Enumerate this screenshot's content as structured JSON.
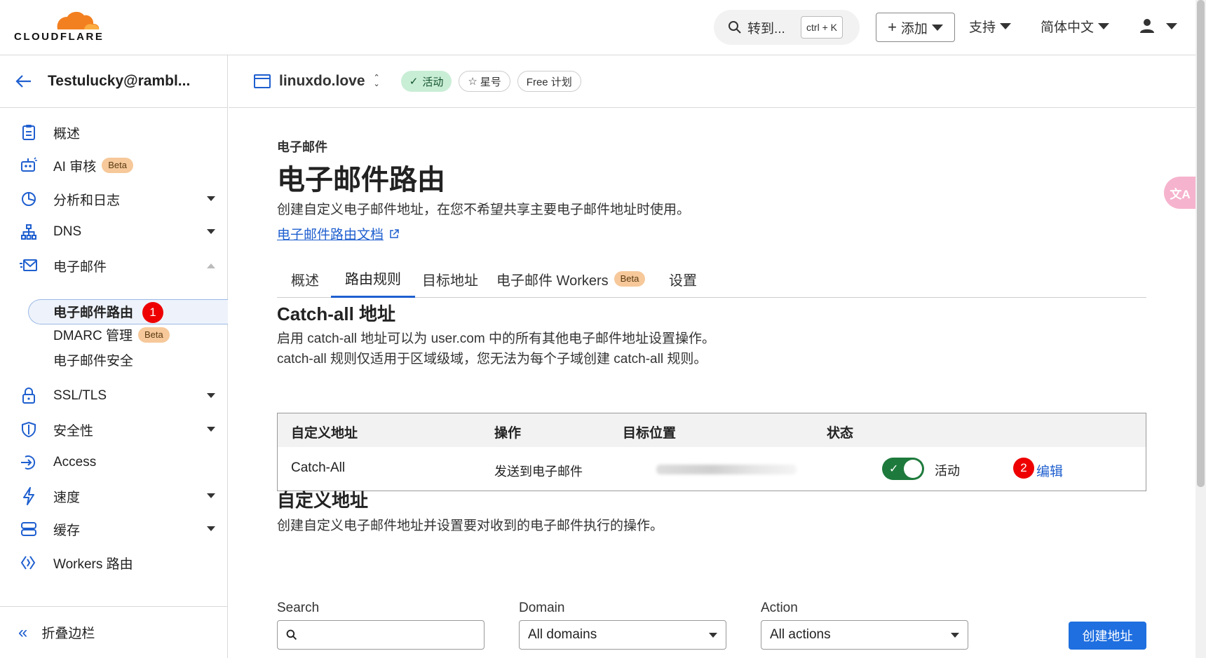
{
  "topbar": {
    "logo_text": "CLOUDFLARE",
    "search_label": "转到...",
    "search_shortcut": "ctrl + K",
    "add_label": "添加",
    "support_label": "支持",
    "language_label": "简体中文"
  },
  "sidebar": {
    "account_name": "Testulucky@rambl...",
    "items": [
      {
        "label": "概述",
        "icon": "document-icon"
      },
      {
        "label": "AI 审核",
        "icon": "robot-icon",
        "badge": "Beta"
      },
      {
        "label": "分析和日志",
        "icon": "chart-pie-icon"
      },
      {
        "label": "DNS",
        "icon": "sitemap-icon"
      },
      {
        "label": "电子邮件",
        "icon": "email-icon"
      },
      {
        "label": "SSL/TLS",
        "icon": "lock-icon"
      },
      {
        "label": "安全性",
        "icon": "shield-icon"
      },
      {
        "label": "Access",
        "icon": "access-icon"
      },
      {
        "label": "速度",
        "icon": "lightning-icon"
      },
      {
        "label": "缓存",
        "icon": "storage-icon"
      },
      {
        "label": "Workers 路由",
        "icon": "workers-icon"
      }
    ],
    "email_subitems": [
      {
        "label": "电子邮件路由",
        "step": "1"
      },
      {
        "label": "DMARC 管理",
        "badge": "Beta"
      },
      {
        "label": "电子邮件安全"
      }
    ],
    "collapse_label": "折叠边栏"
  },
  "zone": {
    "name": "linuxdo.love",
    "status": "活动",
    "star_label": "星号",
    "plan": "Free 计划"
  },
  "main": {
    "eyebrow": "电子邮件",
    "title": "电子邮件路由",
    "description": "创建自定义电子邮件地址，在您不希望共享主要电子邮件地址时使用。",
    "doc_link": "电子邮件路由文档",
    "tabs": [
      {
        "label": "概述"
      },
      {
        "label": "路由规则",
        "active": true
      },
      {
        "label": "目标地址"
      },
      {
        "label": "电子邮件 Workers",
        "badge": "Beta"
      },
      {
        "label": "设置"
      }
    ]
  },
  "catch_all": {
    "heading": "Catch-all 地址",
    "line1": "启用 catch-all 地址可以为 user.com 中的所有其他电子邮件地址设置操作。",
    "line2": "catch-all 规则仅适用于区域级域，您无法为每个子域创建 catch-all 规则。",
    "columns": [
      "自定义地址",
      "操作",
      "目标位置",
      "状态"
    ],
    "row": {
      "address": "Catch-All",
      "action": "发送到电子邮件",
      "status": "活动",
      "enabled": true,
      "edit_label": "编辑",
      "step": "2"
    }
  },
  "custom": {
    "heading": "自定义地址",
    "description": "创建自定义电子邮件地址并设置要对收到的电子邮件执行的操作。",
    "search_label": "Search",
    "domain_label": "Domain",
    "domain_value": "All domains",
    "action_label": "Action",
    "action_value": "All actions",
    "create_label": "创建地址"
  },
  "colors": {
    "accent": "#1f6fe0",
    "link": "#1f5fcf",
    "active_green": "#1e7a3c",
    "beta_bg": "#f6c89a",
    "step_badge": "#e00000",
    "brand_orange": "#f38020"
  }
}
